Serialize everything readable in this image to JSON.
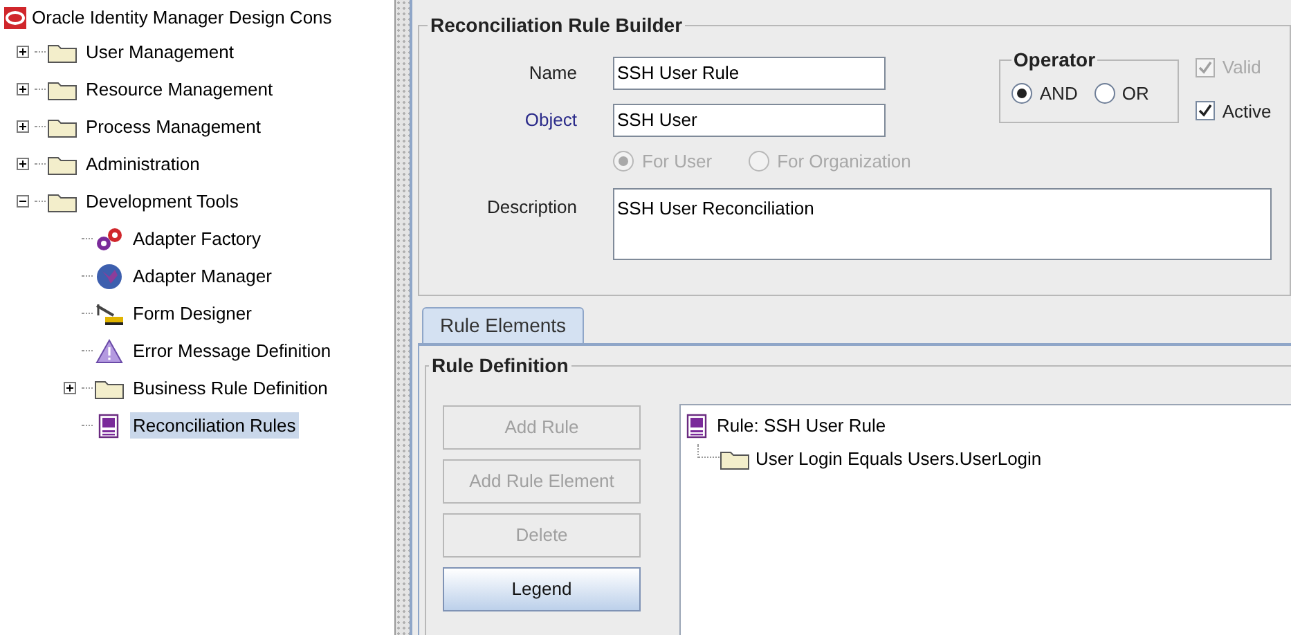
{
  "window": {
    "title": "Oracle Identity Manager Design Cons"
  },
  "navigation_tree": [
    {
      "label": "User Management",
      "kind": "folder",
      "expanded": false,
      "selected": false
    },
    {
      "label": "Resource Management",
      "kind": "folder",
      "expanded": false,
      "selected": false
    },
    {
      "label": "Process Management",
      "kind": "folder",
      "expanded": false,
      "selected": false
    },
    {
      "label": "Administration",
      "kind": "folder",
      "expanded": false,
      "selected": false
    },
    {
      "label": "Development Tools",
      "kind": "folder",
      "expanded": true,
      "selected": false,
      "children": [
        {
          "label": "Adapter Factory",
          "kind": "gears",
          "selected": false
        },
        {
          "label": "Adapter Manager",
          "kind": "globe",
          "selected": false
        },
        {
          "label": "Form Designer",
          "kind": "crane",
          "selected": false
        },
        {
          "label": "Error Message Definition",
          "kind": "warning",
          "selected": false
        },
        {
          "label": "Business Rule Definition",
          "kind": "folder",
          "expanded": false,
          "selected": false
        },
        {
          "label": "Reconciliation Rules",
          "kind": "rule",
          "selected": true
        }
      ]
    }
  ],
  "rule_builder": {
    "title": "Reconciliation Rule Builder",
    "fields": [
      {
        "label": "Name",
        "value": "SSH User Rule",
        "kind": "plain"
      },
      {
        "label": "Object",
        "value": "SSH User",
        "kind": "link"
      }
    ],
    "operator": {
      "title": "Operator",
      "options": [
        {
          "label": "AND",
          "selected": true
        },
        {
          "label": "OR",
          "selected": false
        }
      ]
    },
    "flags": [
      {
        "label": "Valid",
        "checked": true,
        "disabled": true
      },
      {
        "label": "Active",
        "checked": true,
        "disabled": false
      }
    ],
    "target": {
      "disabled": true,
      "options": [
        {
          "label": "For User",
          "selected": true
        },
        {
          "label": "For Organization",
          "selected": false
        }
      ]
    },
    "description": {
      "label": "Description",
      "value": "SSH User Reconciliation"
    }
  },
  "tabs": [
    {
      "label": "Rule Elements",
      "selected": true
    }
  ],
  "rule_definition": {
    "title": "Rule Definition",
    "buttons": [
      {
        "label": "Add Rule",
        "disabled": true
      },
      {
        "label": "Add Rule Element",
        "disabled": true
      },
      {
        "label": "Delete",
        "disabled": true
      },
      {
        "label": "Legend",
        "disabled": false
      }
    ],
    "tree": {
      "label": "Rule: SSH User Rule",
      "kind": "rule",
      "children": [
        {
          "label": "User Login Equals Users.UserLogin",
          "kind": "folder"
        }
      ]
    }
  }
}
